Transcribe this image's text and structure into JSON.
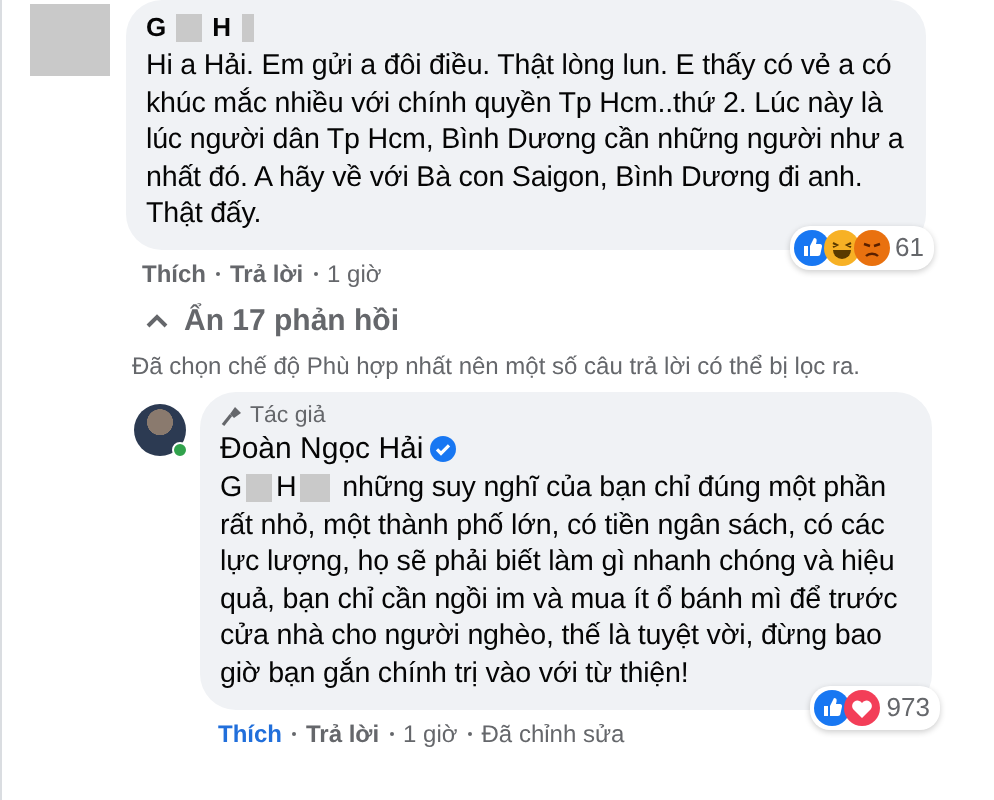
{
  "comment": {
    "author_parts": [
      "G",
      "H"
    ],
    "text": "Hi a Hải. Em gửi a đôi điều. Thật lòng lun. E thấy có vẻ a có khúc mắc nhiều với chính quyền Tp Hcm..thứ 2. Lúc này là lúc người dân Tp Hcm, Bình Dương cần những người như a nhất đó. A hãy về với Bà con Saigon, Bình Dương đi anh. Thật đấy.",
    "reactions": [
      {
        "kind": "like"
      },
      {
        "kind": "haha"
      },
      {
        "kind": "angry"
      }
    ],
    "reaction_count": "61",
    "like_label": "Thích",
    "liked": false,
    "reply_label": "Trả lời",
    "time": "1 giờ"
  },
  "replies_toggle": {
    "label": "Ẩn 17 phản hồi",
    "expanded": true
  },
  "filter_notice": "Đã chọn chế độ Phù hợp nhất nên một số câu trả lời có thể bị lọc ra.",
  "reply": {
    "badge": "Tác giả",
    "author": "Đoàn Ngọc Hải",
    "verified": true,
    "online": true,
    "mention_parts": [
      "G",
      "H"
    ],
    "text": "những suy nghĩ của bạn chỉ đúng một phần rất nhỏ, một thành phố lớn, có tiền ngân sách, có các lực lượng, họ sẽ phải biết làm gì nhanh chóng và hiệu quả, bạn chỉ cần ngồi im và mua ít ổ bánh mì để trước cửa nhà cho người nghèo, thế là tuyệt vời, đừng bao giờ bạn gắn chính trị vào với từ thiện!",
    "reactions": [
      {
        "kind": "like"
      },
      {
        "kind": "love"
      }
    ],
    "reaction_count": "973",
    "like_label": "Thích",
    "liked": true,
    "reply_label": "Trả lời",
    "time": "1 giờ",
    "edited": "Đã chỉnh sửa"
  }
}
